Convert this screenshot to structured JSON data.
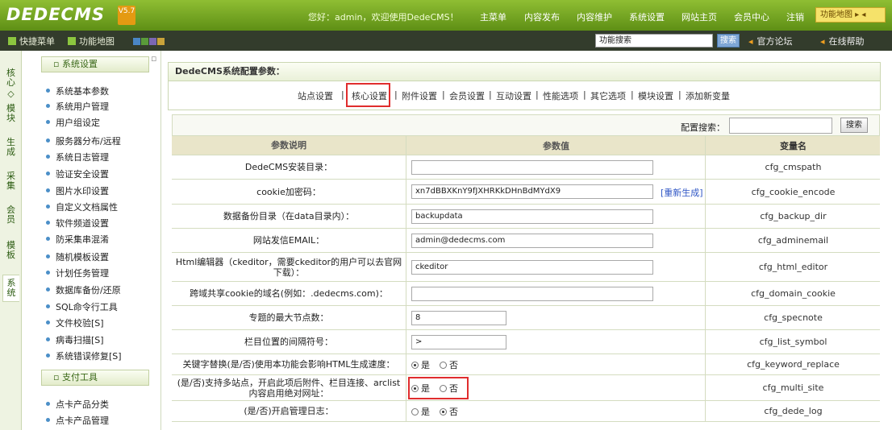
{
  "header": {
    "logo": "DEDECMS",
    "version": "V5.7",
    "greeting": "您好：admin，欢迎使用DedeCMS！",
    "nav": [
      "主菜单",
      "内容发布",
      "内容维护",
      "系统设置",
      "网站主页",
      "会员中心",
      "注销"
    ],
    "quick_label": "功能地图 ▸ ◂"
  },
  "toolbar": {
    "items": [
      "快捷菜单",
      "功能地图"
    ],
    "search_value": "功能搜索",
    "search_button": "搜索",
    "links": [
      "官方论坛",
      "在线帮助"
    ],
    "dot_colors": [
      "#4a86c5",
      "#5a9b3a",
      "#7b67b3",
      "#c9a33a"
    ]
  },
  "left_tabs": [
    "核心",
    "模块",
    "生成",
    "采集",
    "会员",
    "模板",
    "系统"
  ],
  "sidebar": {
    "section1": "系统设置",
    "items1": [
      "系统基本参数",
      "系统用户管理",
      "用户组设定",
      "服务器分布/远程",
      "系统日志管理",
      "验证安全设置",
      "图片水印设置",
      "自定义文档属性",
      "软件频道设置",
      "防采集串混淆",
      "随机模板设置",
      "计划任务管理",
      "数据库备份/还原",
      "SQL命令行工具",
      "文件校验[S]",
      "病毒扫描[S]",
      "系统错误修复[S]"
    ],
    "section2": "支付工具",
    "items2": [
      "点卡产品分类",
      "点卡产品管理"
    ]
  },
  "main": {
    "title": "DedeCMS系统配置参数：",
    "tabs": [
      "站点设置",
      "核心设置",
      "附件设置",
      "会员设置",
      "互动设置",
      "性能选项",
      "其它选项",
      "模块设置",
      "添加新变量"
    ],
    "config_search_label": "配置搜索：",
    "config_search_button": "搜索",
    "headers": [
      "参数说明",
      "参数值",
      "变量名"
    ],
    "rows": [
      {
        "label": "DedeCMS安装目录：",
        "value": "",
        "var": "cfg_cmspath"
      },
      {
        "label": "cookie加密码：",
        "value": "xn7dBBXKnY9fJXHRKkDHnBdMYdX9",
        "var": "cfg_cookie_encode",
        "extra": "[重新生成]"
      },
      {
        "label": "数据备份目录（在data目录内）：",
        "value": "backupdata",
        "var": "cfg_backup_dir"
      },
      {
        "label": "网站发信EMAIL：",
        "value": "admin@dedecms.com",
        "var": "cfg_adminemail"
      },
      {
        "label": "Html编辑器（ckeditor，需要ckeditor的用户可以去官网下载）：",
        "value": "ckeditor",
        "var": "cfg_html_editor"
      },
      {
        "label": "跨域共享cookie的域名(例如：.dedecms.com)：",
        "value": "",
        "var": "cfg_domain_cookie"
      },
      {
        "label": "专题的最大节点数：",
        "value": "8",
        "var": "cfg_specnote"
      },
      {
        "label": "栏目位置的间隔符号：",
        "value": ">",
        "var": "cfg_list_symbol"
      },
      {
        "label": "关键字替换(是/否)使用本功能会影响HTML生成速度：",
        "options": [
          "是",
          "否"
        ],
        "selected": 0,
        "var": "cfg_keyword_replace"
      },
      {
        "label": "(是/否)支持多站点，开启此项后附件、栏目连接、arclist内容启用绝对网址：",
        "options": [
          "是",
          "否"
        ],
        "selected": 0,
        "var": "cfg_multi_site"
      },
      {
        "label": "(是/否)开启管理日志：",
        "options": [
          "是",
          "否"
        ],
        "selected": 1,
        "var": "cfg_dede_log"
      }
    ]
  }
}
